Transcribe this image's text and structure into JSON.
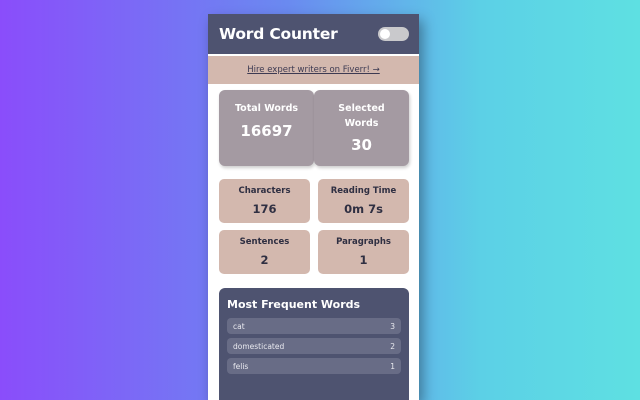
{
  "header": {
    "title": "Word Counter",
    "toggle_icon": "toggle-switch-icon"
  },
  "banner": {
    "link_text": "Hire expert writers on Fiverr! →"
  },
  "stats": {
    "total_words": {
      "label": "Total Words",
      "value": "16697"
    },
    "selected_words": {
      "label": "Selected Words",
      "value": "30"
    },
    "characters": {
      "label": "Characters",
      "value": "176"
    },
    "reading_time": {
      "label": "Reading Time",
      "value": "0m 7s"
    },
    "sentences": {
      "label": "Sentences",
      "value": "2"
    },
    "paragraphs": {
      "label": "Paragraphs",
      "value": "1"
    }
  },
  "frequent": {
    "title": "Most Frequent Words",
    "items": [
      {
        "word": "cat",
        "count": "3"
      },
      {
        "word": "domesticated",
        "count": "2"
      },
      {
        "word": "felis",
        "count": "1"
      }
    ]
  },
  "colors": {
    "header_bg": "#4e5370",
    "banner_bg": "#d3b8ae",
    "big_card_bg": "#a49aa2",
    "small_card_bg": "#d3b8ae"
  }
}
